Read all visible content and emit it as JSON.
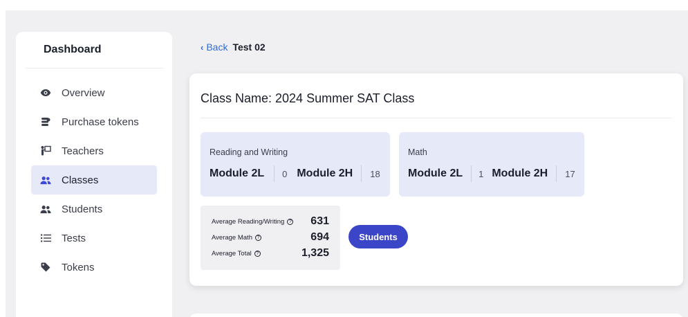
{
  "sidebar": {
    "title": "Dashboard",
    "items": [
      {
        "label": "Overview",
        "icon": "eye-icon",
        "active": false
      },
      {
        "label": "Purchase tokens",
        "icon": "coins-icon",
        "active": false
      },
      {
        "label": "Teachers",
        "icon": "teacher-icon",
        "active": false
      },
      {
        "label": "Classes",
        "icon": "users-icon",
        "active": true
      },
      {
        "label": "Students",
        "icon": "users-icon",
        "active": false
      },
      {
        "label": "Tests",
        "icon": "list-icon",
        "active": false
      },
      {
        "label": "Tokens",
        "icon": "tag-icon",
        "active": false
      }
    ]
  },
  "header": {
    "back_label": "Back",
    "crumb": "Test 02"
  },
  "class_card": {
    "title": "Class Name: 2024 Summer SAT Class",
    "reading_writing": {
      "label": "Reading and Writing",
      "module_2l_label": "Module 2L",
      "module_2l_count": "0",
      "module_2h_label": "Module 2H",
      "module_2h_count": "18"
    },
    "math": {
      "label": "Math",
      "module_2l_label": "Module 2L",
      "module_2l_count": "1",
      "module_2h_label": "Module 2H",
      "module_2h_count": "17"
    },
    "averages": {
      "reading_writing_label": "Average Reading/Writing",
      "reading_writing_value": "631",
      "math_label": "Average Math",
      "math_value": "694",
      "total_label": "Average Total",
      "total_value": "1,325"
    },
    "students_button": "Students"
  },
  "colors": {
    "accent": "#3b45c8",
    "active_bg": "#e6e9f8",
    "link": "#2f6bdc",
    "page_bg": "#f0f0f2"
  }
}
